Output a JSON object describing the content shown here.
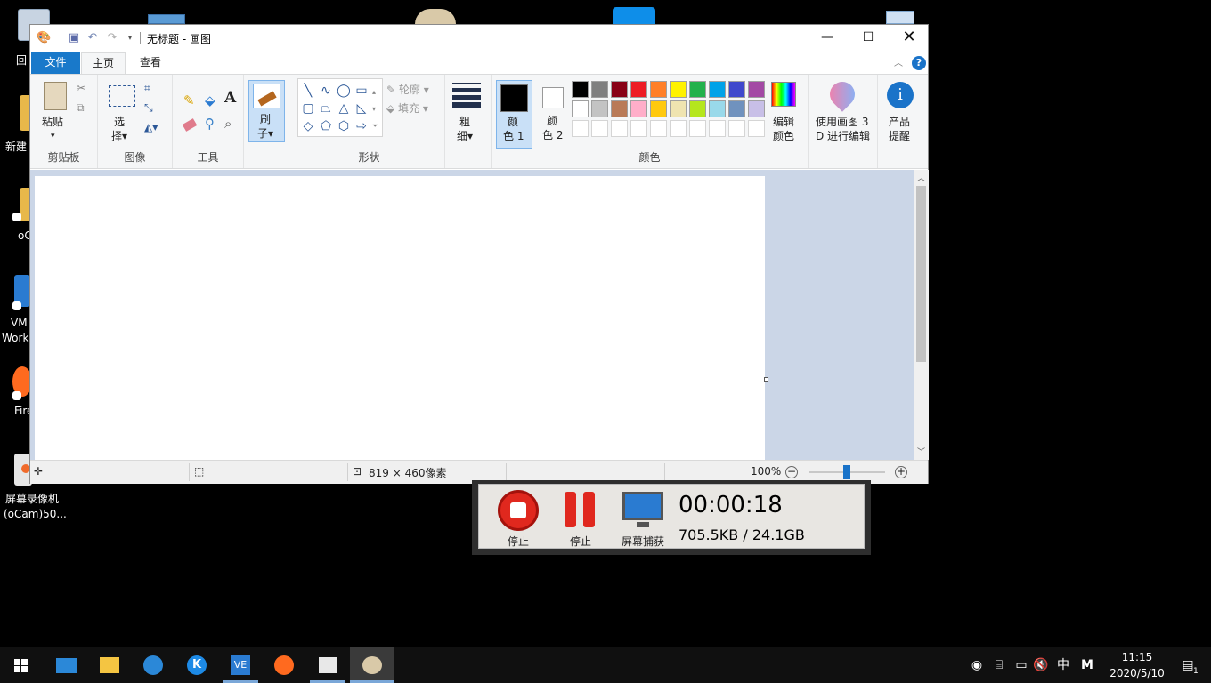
{
  "desktop": {
    "icons": [
      {
        "label": "回",
        "name": "recycle-bin"
      },
      {
        "label": "新建",
        "name": "new-folder"
      },
      {
        "label": "oC",
        "name": "ocam-folder"
      },
      {
        "label": "VM",
        "label2": "Work",
        "name": "vmware"
      },
      {
        "label": "Fire",
        "name": "firefox"
      },
      {
        "label": "屏幕录像机",
        "label2": "(oCam)50...",
        "name": "ocam-recorder"
      }
    ]
  },
  "paint": {
    "title": "无标题 - 画图",
    "tabs": [
      "文件",
      "主页",
      "查看"
    ],
    "clipboard": {
      "paste": "粘贴",
      "group": "剪贴板"
    },
    "image": {
      "select1": "选",
      "select2": "择",
      "group": "图像"
    },
    "tools": {
      "group": "工具"
    },
    "brush": {
      "l1": "刷",
      "l2": "子"
    },
    "shapes": {
      "outline": "轮廓",
      "fill": "填充",
      "group": "形状"
    },
    "size": {
      "l1": "粗",
      "l2": "细"
    },
    "color1": {
      "l1": "颜",
      "l2": "色 1"
    },
    "color2": {
      "l1": "颜",
      "l2": "色 2"
    },
    "colors_group": "颜色",
    "edit_colors": {
      "l1": "编辑",
      "l2": "颜色"
    },
    "paint3d": {
      "l1": "使用画图 3",
      "l2": "D 进行编辑"
    },
    "product": {
      "l1": "产品",
      "l2": "提醒"
    },
    "palette_row1": [
      "#000000",
      "#7f7f7f",
      "#880015",
      "#ed1c24",
      "#ff7f27",
      "#fff200",
      "#22b14c",
      "#00a2e8",
      "#3f48cc",
      "#a349a4"
    ],
    "palette_row2": [
      "#ffffff",
      "#c3c3c3",
      "#b97a57",
      "#ffaec9",
      "#ffc90e",
      "#efe4b0",
      "#b5e61d",
      "#99d9ea",
      "#7092be",
      "#c8bfe7"
    ],
    "status": {
      "size": "819 × 460像素",
      "zoom": "100%"
    }
  },
  "ocam": {
    "stop1": "停止",
    "pause": "停止",
    "capture": "屏幕捕获",
    "time": "00:00:18",
    "size": "705.5KB / 24.1GB"
  },
  "taskbar": {
    "ime": "中",
    "ime2": "M",
    "time": "11:15",
    "date": "2020/5/10"
  }
}
